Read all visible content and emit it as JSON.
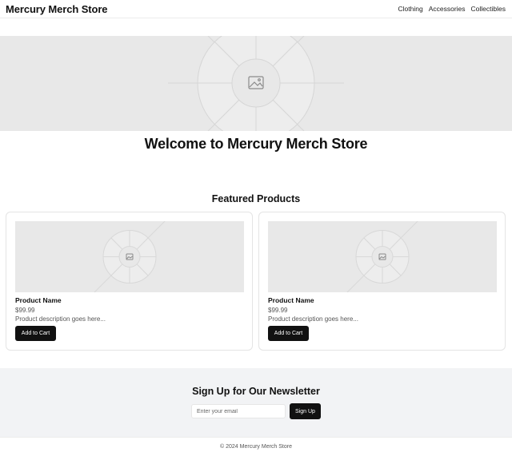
{
  "header": {
    "brand": "Mercury Merch Store",
    "nav": [
      "Clothing",
      "Accessories",
      "Collectibles"
    ]
  },
  "hero": {
    "image_icon": "image-placeholder-icon",
    "heading": "Welcome to Mercury Merch Store"
  },
  "featured": {
    "title": "Featured Products",
    "products": [
      {
        "name": "Product Name",
        "price": "$99.99",
        "description": "Product description goes here...",
        "button": "Add to Cart",
        "image_icon": "image-placeholder-icon"
      },
      {
        "name": "Product Name",
        "price": "$99.99",
        "description": "Product description goes here...",
        "button": "Add to Cart",
        "image_icon": "image-placeholder-icon"
      }
    ]
  },
  "newsletter": {
    "title": "Sign Up for Our Newsletter",
    "placeholder": "Enter your email",
    "button": "Sign Up"
  },
  "footer": {
    "text": "© 2024 Mercury Merch Store"
  },
  "colors": {
    "primary": "#111111",
    "placeholder_bg": "#e8e8e8",
    "newsletter_bg": "#f2f3f5"
  }
}
